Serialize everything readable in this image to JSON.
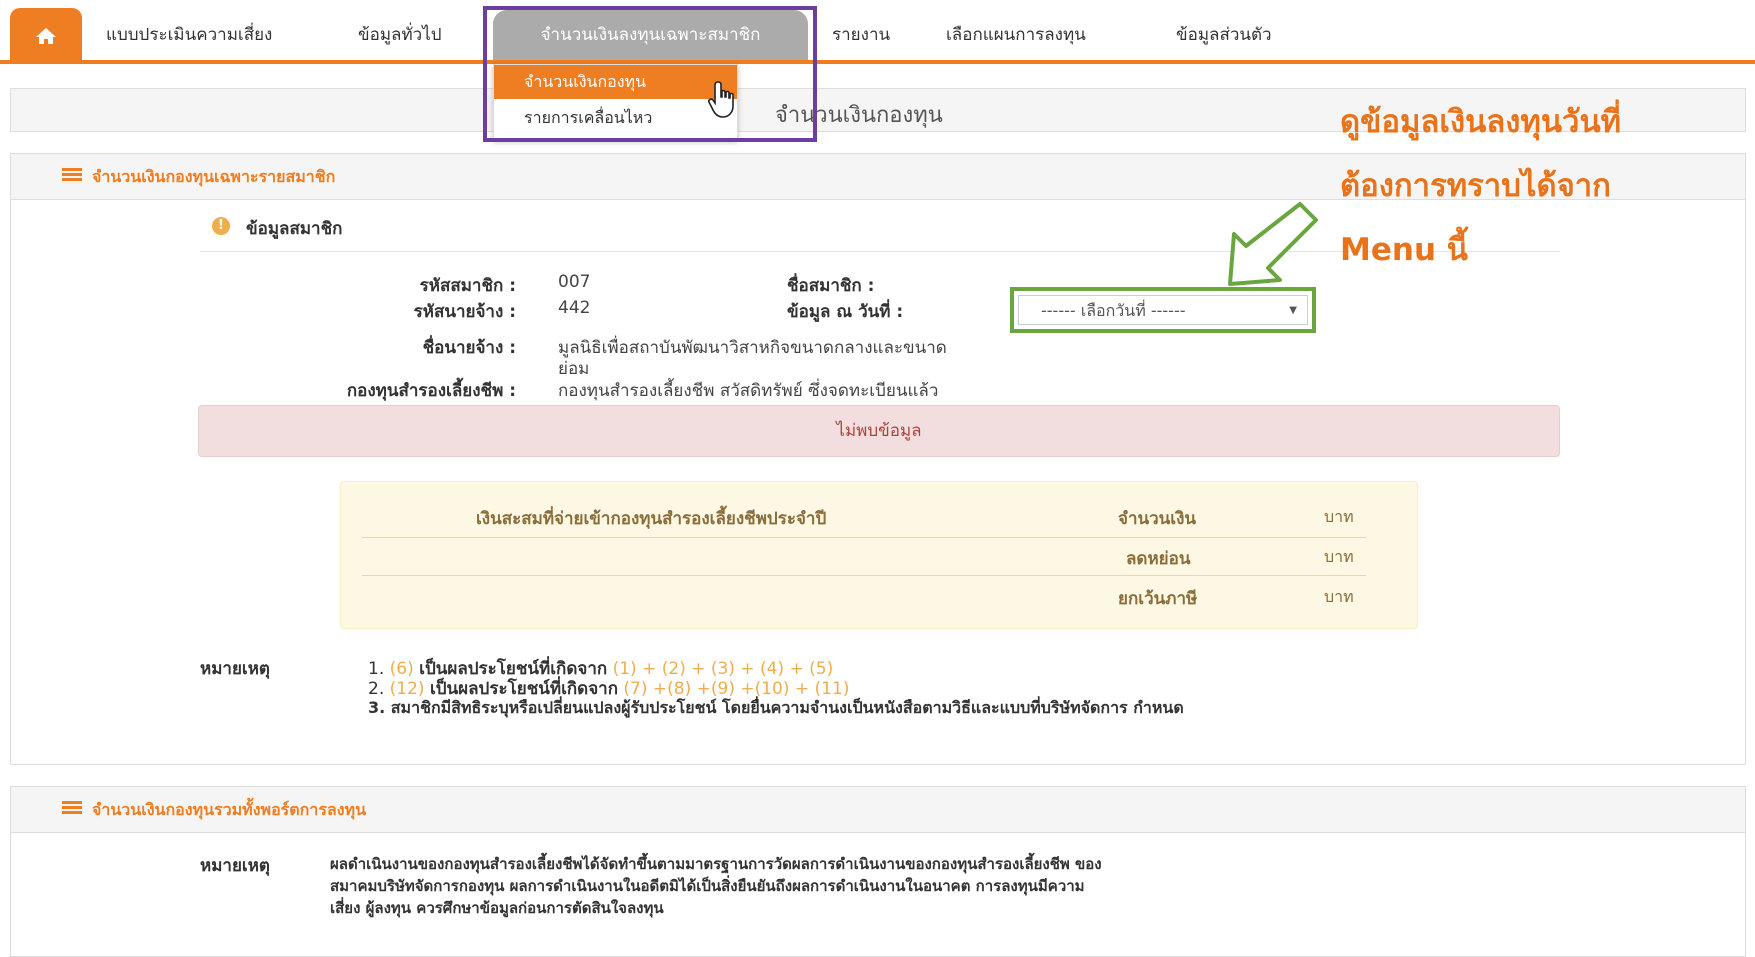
{
  "nav": {
    "items": [
      "แบบประเมินความเสี่ยง",
      "ข้อมูลทั่วไป",
      "จำนวนเงินลงทุนเฉพาะสมาชิก",
      "รายงาน",
      "เลือกแผนการลงทุน",
      "ข้อมูลส่วนตัว"
    ],
    "active_index": 2,
    "dropdown": [
      "จำนวนเงินกองทุน",
      "รายการเคลื่อนไหว"
    ]
  },
  "breadcrumb": "จำนวนเงินกองทุน",
  "annotation": {
    "line1": "ดูข้อมูลเงินลงทุนวันที่",
    "line2": "ต้องการทราบได้จาก",
    "line3": "Menu นี้"
  },
  "panel1": {
    "title": "จำนวนเงินกองทุนเฉพาะรายสมาชิก",
    "subtitle": "ข้อมูลสมาชิก",
    "fields": {
      "member_id_label": "รหัสสมาชิก :",
      "member_id": "007",
      "employer_id_label": "รหัสนายจ้าง :",
      "employer_id": "442",
      "employer_name_label": "ชื่อนายจ้าง :",
      "employer_name_1": "มูลนิธิเพื่อสถาบันพัฒนาวิสาหกิจขนาดกลางและขนาด",
      "employer_name_2": "ย่อม",
      "fund_label": "กองทุนสำรองเลี้ยงชีพ :",
      "fund": "กองทุนสำรองเลี้ยงชีพ สวัสดิทรัพย์ ซึ่งจดทะเบียนแล้ว",
      "member_name_label": "ชื่อสมาชิก :",
      "date_label": "ข้อมูล ณ วันที่ :",
      "date_select": "------ เลือกวันที่ ------"
    },
    "alert": "ไม่พบข้อมูล",
    "table": {
      "heading": "เงินสะสมที่จ่ายเข้ากองทุนสำรองเลี้ยงชีพประจำปี",
      "rows": [
        {
          "label": "จำนวนเงิน",
          "unit": "บาท"
        },
        {
          "label": "ลดหย่อน",
          "unit": "บาท"
        },
        {
          "label": "ยกเว้นภาษี",
          "unit": "บาท"
        }
      ]
    },
    "remarks_label": "หมายเหตุ",
    "remarks": {
      "r1_num": "1.",
      "r1_a": "(6)",
      "r1_b": "เป็นผลประโยชน์ที่เกิดจาก",
      "r1_c": "(1) + (2) + (3) + (4) + (5)",
      "r2_num": "2.",
      "r2_a": "(12)",
      "r2_b": "เป็นผลประโยชน์ที่เกิดจาก",
      "r2_c": "(7) +(8) +(9) +(10) + (11)",
      "r3": "3. สมาชิกมีสิทธิระบุหรือเปลี่ยนแปลงผู้รับประโยชน์ โดยยื่นความจำนงเป็นหนังสือตามวิธีและแบบที่บริษัทจัดการ กำหนด"
    }
  },
  "panel2": {
    "title": "จำนวนเงินกองทุนรวมทั้งพอร์ตการลงทุน",
    "remarks_label": "หมายเหตุ",
    "text1": "ผลดำเนินงานของกองทุนสำรองเลี้ยงชีพได้จัดทำขึ้นตามมาตรฐานการวัดผลการดำเนินงานของกองทุนสำรองเลี้ยงชีพ ของ",
    "text2": "สมาคมบริษัทจัดการกองทุน ผลการดำเนินงานในอดีตมิได้เป็นสิ่งยืนยันถึงผลการดำเนินงานในอนาคต การลงทุนมีความ",
    "text3": "เสี่ยง ผู้ลงทุน ควรศึกษาข้อมูลก่อนการตัดสินใจลงทุน"
  },
  "colors": {
    "accent": "#ef7d21",
    "highlight_box": "#6b3fa0",
    "select_box": "#6aa640"
  }
}
